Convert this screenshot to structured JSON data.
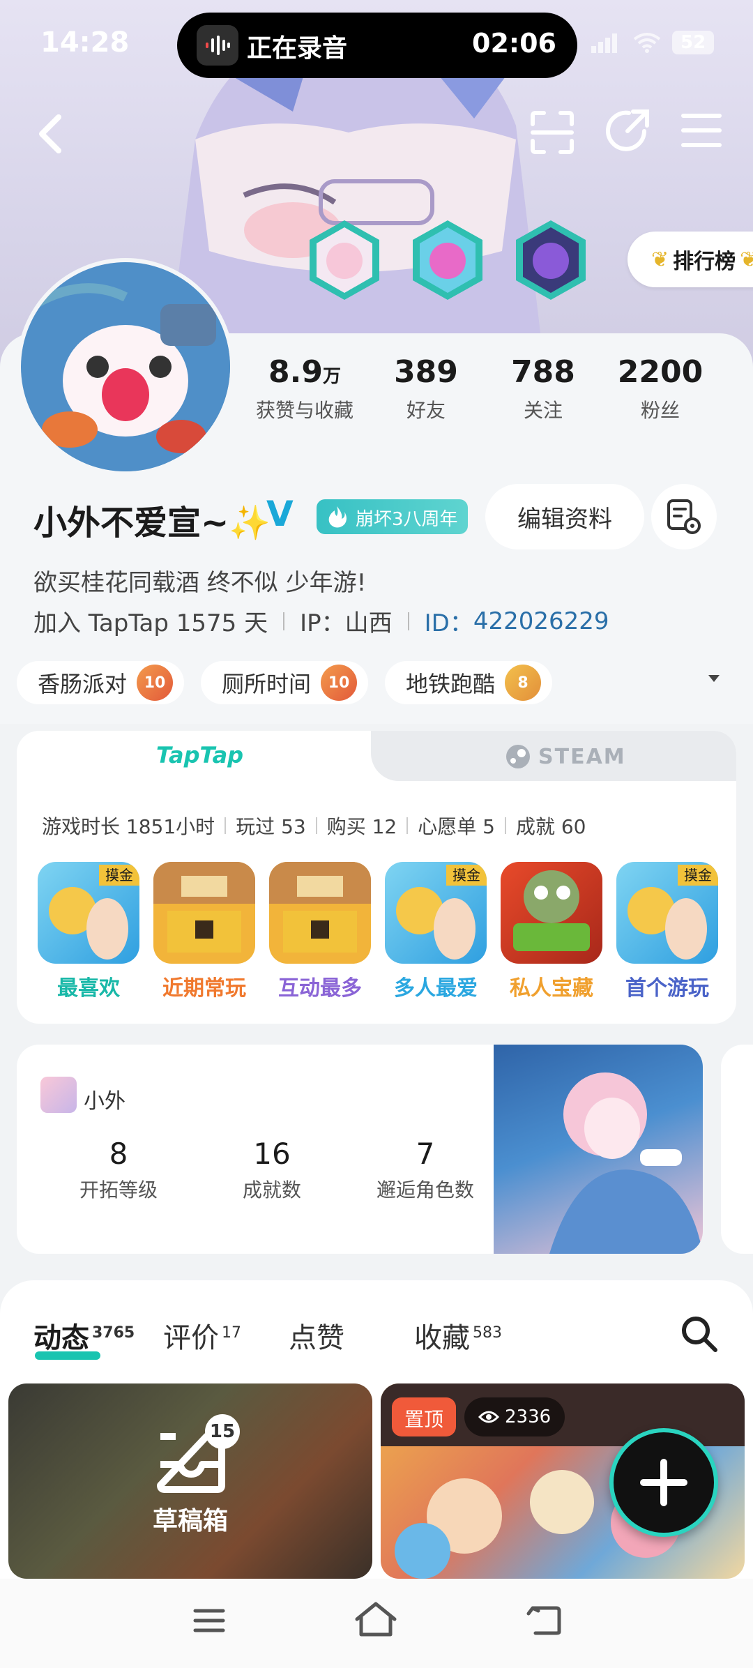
{
  "status_bar": {
    "time": "14:28",
    "recording_label": "正在录音",
    "recording_time": "02:06",
    "battery": "52"
  },
  "header": {
    "rank_label": "排行榜"
  },
  "profile": {
    "stats": [
      {
        "value": "8.9",
        "unit": "万",
        "label": "获赞与收藏"
      },
      {
        "value": "389",
        "unit": "",
        "label": "好友"
      },
      {
        "value": "788",
        "unit": "",
        "label": "关注"
      },
      {
        "value": "2200",
        "unit": "",
        "label": "粉丝"
      }
    ],
    "username": "小外不爱宣~✨",
    "verified_mark": "V",
    "anniversary_badge": "崩坏3八周年",
    "edit_button": "编辑资料",
    "bio": "欲买桂花同载酒 终不似 少年游!",
    "joined": "加入 TapTap 1575 天",
    "ip": "IP：山西",
    "id_label": "ID：",
    "id_value": "422026229"
  },
  "game_tags": [
    {
      "name": "香肠派对",
      "level": "10"
    },
    {
      "name": "厕所时间",
      "level": "10"
    },
    {
      "name": "地铁跑酷",
      "level": "8"
    }
  ],
  "platform_card": {
    "tab_taptap": "TapTap",
    "tab_steam": "STEAM",
    "stats": [
      "游戏时长 1851小时",
      "玩过 53",
      "购买 12",
      "心愿单 5",
      "成就 60"
    ],
    "games": [
      {
        "label": "最喜欢",
        "badge": "摸金",
        "color": "#19b8a8"
      },
      {
        "label": "近期常玩",
        "badge": "",
        "color": "#f0792e"
      },
      {
        "label": "互动最多",
        "badge": "",
        "color": "#8a64d6"
      },
      {
        "label": "多人最爱",
        "badge": "摸金",
        "color": "#2aa7e0"
      },
      {
        "label": "私人宝藏",
        "badge": "",
        "color": "#f0a02e"
      },
      {
        "label": "首个游玩",
        "badge": "摸金",
        "color": "#4a63c8"
      }
    ]
  },
  "starrail_card": {
    "name": "小外",
    "stats": [
      {
        "value": "8",
        "label": "开拓等级"
      },
      {
        "value": "16",
        "label": "成就数"
      },
      {
        "value": "7",
        "label": "邂逅角色数"
      }
    ]
  },
  "tabs": [
    {
      "label": "动态",
      "count": "3765"
    },
    {
      "label": "评价",
      "count": "17"
    },
    {
      "label": "点赞",
      "count": ""
    },
    {
      "label": "收藏",
      "count": "583"
    }
  ],
  "posts": {
    "draft_label": "草稿箱",
    "draft_count": "15",
    "pinned_label": "置顶",
    "views": "2336"
  }
}
